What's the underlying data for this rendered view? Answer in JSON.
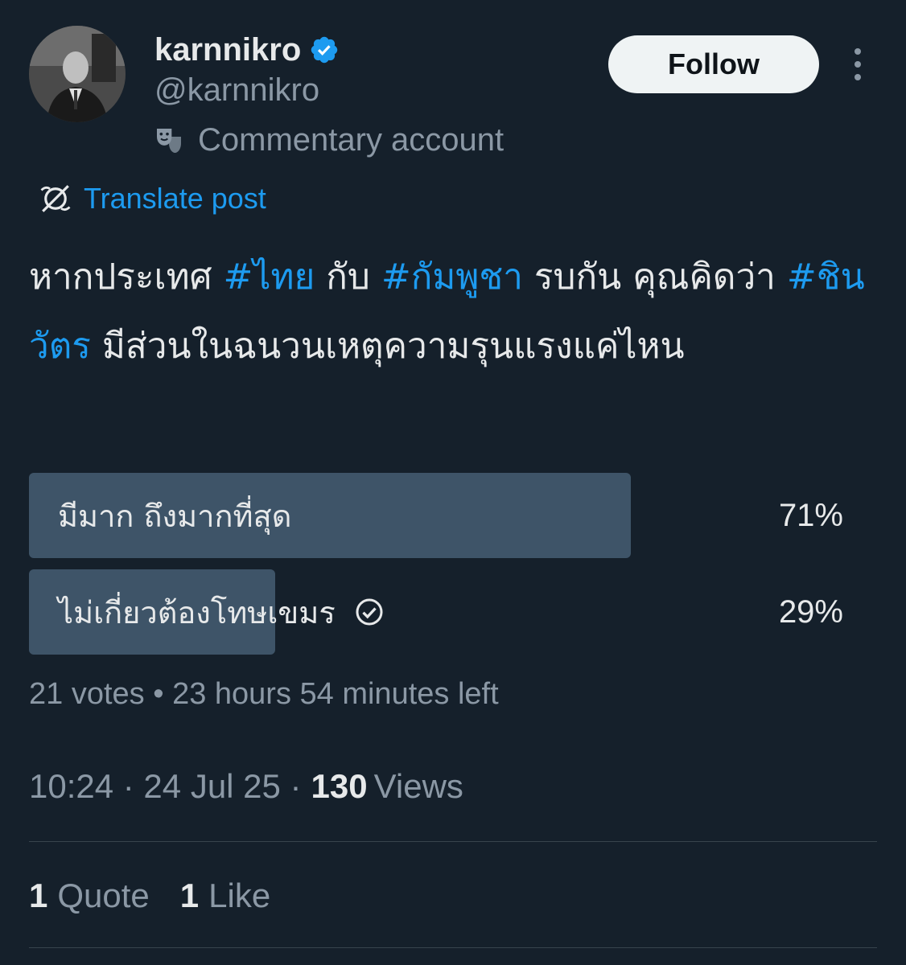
{
  "author": {
    "display_name": "karnnikro",
    "handle": "@karnnikro",
    "label": "Commentary account",
    "verified_icon": "verified-badge-icon",
    "label_icon": "theater-masks-icon"
  },
  "actions": {
    "follow_label": "Follow",
    "more_icon": "more-options-icon"
  },
  "translate": {
    "label": "Translate post",
    "icon": "translate-icon"
  },
  "post": {
    "segments": [
      {
        "text": "หากประเทศ ",
        "hashtag": false
      },
      {
        "text": "#ไทย",
        "hashtag": true
      },
      {
        "text": " กับ ",
        "hashtag": false
      },
      {
        "text": "#กัมพูชา",
        "hashtag": true
      },
      {
        "text": " รบกัน คุณคิดว่า ",
        "hashtag": false
      },
      {
        "text": "#ชินวัตร",
        "hashtag": true
      },
      {
        "text": " มีส่วนในฉนวนเหตุความรุนแรงแค่ไหน",
        "hashtag": false
      }
    ]
  },
  "poll": {
    "options": [
      {
        "label": "มีมาก ถึงมากที่สุด",
        "percent_text": "71%",
        "percent": 71,
        "chosen": false
      },
      {
        "label": "ไม่เกี่ยวต้องโทษเขมร",
        "percent_text": "29%",
        "percent": 29,
        "chosen": true
      }
    ],
    "meta": "21 votes • 23 hours 54 minutes left",
    "chosen_icon": "check-circle-icon"
  },
  "timestamp": {
    "time_date": "10:24 · 24 Jul 25 ·",
    "views_count": "130",
    "views_label": "Views"
  },
  "engagement": {
    "quotes_count": "1",
    "quotes_label": "Quote",
    "likes_count": "1",
    "likes_label": "Like"
  },
  "colors": {
    "background": "#15202b",
    "accent": "#1d9bf0",
    "poll_bar": "#3e5468",
    "muted_text": "#8b98a5"
  }
}
